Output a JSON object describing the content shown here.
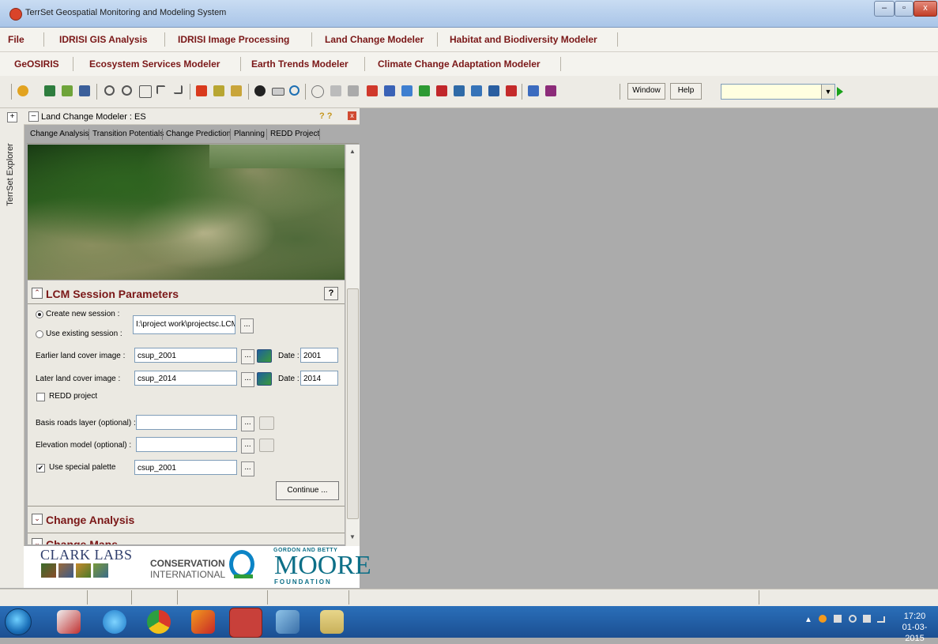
{
  "window": {
    "title": "TerrSet Geospatial Monitoring and Modeling System",
    "minimize": "–",
    "maximize": "▫",
    "close": "x"
  },
  "menu_row1": [
    "File",
    "IDRISI GIS Analysis",
    "IDRISI Image Processing",
    "Land Change Modeler",
    "Habitat and Biodiversity Modeler"
  ],
  "menu_row2": [
    "GeOSIRIS",
    "Ecosystem Services Modeler",
    "Earth Trends Modeler",
    "Climate Change Adaptation Modeler"
  ],
  "toolbar": {
    "window_label": "Window",
    "help_label": "Help",
    "combo_value": "",
    "combo_arrow": "▼"
  },
  "dock": {
    "vertical_label": "TerrSet Explorer",
    "expand": "+",
    "collapse": "–"
  },
  "panel": {
    "title": "Land Change Modeler : ES",
    "help_icons": "? ?",
    "close": "x",
    "tabs": [
      "Change Analysis",
      "Transition Potentials",
      "Change Prediction",
      "Planning",
      "REDD Project"
    ],
    "active_tab": "Change Analysis"
  },
  "lcm": {
    "header": "LCM Session Parameters",
    "collapse_icon": "⌃",
    "help_label": "?",
    "create_new_session": "Create new session :",
    "use_existing_session": "Use existing session :",
    "session_path": "I:\\project work\\projectsc.LCM",
    "earlier_label": "Earlier land cover image :",
    "earlier_value": "csup_2001",
    "earlier_date_label": "Date :",
    "earlier_date": "2001",
    "later_label": "Later land cover image :",
    "later_value": "csup_2014",
    "later_date_label": "Date :",
    "later_date": "2014",
    "redd_label": "REDD project",
    "roads_label": "Basis roads layer (optional) :",
    "roads_value": "",
    "elevation_label": "Elevation model (optional) :",
    "elevation_value": "",
    "palette_label": "Use special palette",
    "palette_value": "csup_2001",
    "palette_checked": "✔",
    "browse": "...",
    "continue_label": "Continue ..."
  },
  "sections": {
    "change_analysis": "Change Analysis",
    "change_maps": "Change Maps",
    "expand_icon": "⌄"
  },
  "logos": {
    "clark": "CLARK LABS",
    "ci_line1": "CONSERVATION",
    "ci_line2": "INTERNATIONAL",
    "moore_small": "GORDON AND BETTY",
    "moore": "MOORE",
    "moore_foundation": "FOUNDATION"
  },
  "taskbar": {
    "time": "17:20",
    "date": "01-03-2015",
    "tray_arrow": "▲"
  }
}
